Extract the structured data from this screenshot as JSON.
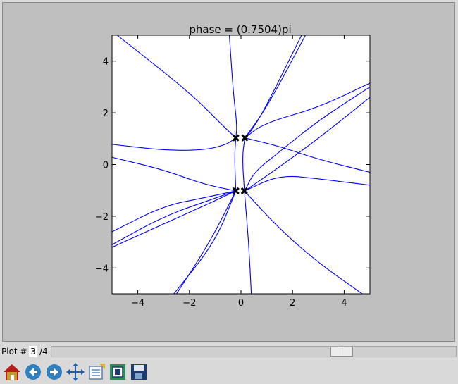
{
  "plot": {
    "title": "phase = (0.7504)pi",
    "xlim": [
      -5,
      5
    ],
    "ylim": [
      -5,
      5
    ],
    "xticks": [
      "−4",
      "−2",
      "0",
      "2",
      "4"
    ],
    "yticks": [
      "4",
      "2",
      "0",
      "−2",
      "−4"
    ],
    "xtick_values": [
      -4,
      -2,
      0,
      2,
      4
    ],
    "ytick_values": [
      4,
      2,
      0,
      -2,
      -4
    ],
    "line_color": "#0000ff",
    "marker_color": "#000000",
    "background": "#ffffff",
    "canvas_bg": "#bfbfbf"
  },
  "chart_data": {
    "type": "line",
    "title": "phase = (0.7504)pi",
    "xlabel": "",
    "ylabel": "",
    "xlim": [
      -5,
      5
    ],
    "ylim": [
      -5,
      5
    ],
    "grid": false,
    "markers": [
      {
        "x": -0.2,
        "y": 1.03
      },
      {
        "x": 0.15,
        "y": 1.03
      },
      {
        "x": -0.2,
        "y": -1.02
      },
      {
        "x": 0.13,
        "y": -1.02
      }
    ],
    "series": [
      {
        "values": [
          [
            -4.8,
            5.0
          ],
          [
            -2.0,
            2.8
          ],
          [
            -0.6,
            1.4
          ],
          [
            -0.2,
            1.03
          ]
        ]
      },
      {
        "values": [
          [
            -0.45,
            5.0
          ],
          [
            -0.3,
            2.8
          ],
          [
            -0.15,
            1.5
          ],
          [
            -0.2,
            1.03
          ],
          [
            -0.25,
            0.3
          ],
          [
            -0.2,
            -1.02
          ]
        ]
      },
      {
        "values": [
          [
            -5.0,
            0.78
          ],
          [
            -3.0,
            0.55
          ],
          [
            -1.5,
            0.55
          ],
          [
            -0.6,
            0.75
          ],
          [
            -0.2,
            1.03
          ]
        ]
      },
      {
        "values": [
          [
            -5.0,
            0.28
          ],
          [
            -3.0,
            -0.2
          ],
          [
            -1.5,
            -0.75
          ],
          [
            -0.2,
            -1.02
          ]
        ]
      },
      {
        "values": [
          [
            2.5,
            5.0
          ],
          [
            1.0,
            2.2
          ],
          [
            0.15,
            1.03
          ]
        ]
      },
      {
        "values": [
          [
            2.35,
            5.0
          ],
          [
            0.9,
            2.1
          ],
          [
            0.4,
            1.3
          ],
          [
            0.15,
            1.03
          ]
        ]
      },
      {
        "values": [
          [
            5.0,
            3.15
          ],
          [
            3.0,
            2.2
          ],
          [
            0.9,
            1.6
          ],
          [
            0.15,
            1.03
          ]
        ]
      },
      {
        "values": [
          [
            5.0,
            3.0
          ],
          [
            3.0,
            1.7
          ],
          [
            1.5,
            0.5
          ],
          [
            0.5,
            -0.3
          ],
          [
            0.15,
            -1.02
          ]
        ]
      },
      {
        "values": [
          [
            5.0,
            2.6
          ],
          [
            3.0,
            1.0
          ],
          [
            1.2,
            -0.3
          ],
          [
            0.15,
            -1.02
          ]
        ]
      },
      {
        "values": [
          [
            0.15,
            1.03
          ],
          [
            0.05,
            0.3
          ],
          [
            0.13,
            -1.02
          ],
          [
            0.3,
            -3.0
          ],
          [
            0.4,
            -5.0
          ]
        ]
      },
      {
        "values": [
          [
            0.15,
            1.03
          ],
          [
            1.5,
            0.7
          ],
          [
            3.0,
            0.2
          ],
          [
            5.0,
            -0.3
          ]
        ]
      },
      {
        "values": [
          [
            0.15,
            -1.02
          ],
          [
            1.5,
            -0.4
          ],
          [
            3.0,
            -0.55
          ],
          [
            5.0,
            -0.8
          ]
        ]
      },
      {
        "values": [
          [
            0.13,
            -1.02
          ],
          [
            1.5,
            -2.5
          ],
          [
            3.0,
            -3.8
          ],
          [
            4.7,
            -5.0
          ]
        ]
      },
      {
        "values": [
          [
            -0.2,
            -1.02
          ],
          [
            -1.0,
            -3.0
          ],
          [
            -2.6,
            -5.0
          ]
        ]
      },
      {
        "values": [
          [
            -0.2,
            -1.02
          ],
          [
            -1.2,
            -3.0
          ],
          [
            -2.5,
            -5.0
          ]
        ]
      },
      {
        "values": [
          [
            -5.0,
            -2.6
          ],
          [
            -3.0,
            -1.6
          ],
          [
            -1.5,
            -1.3
          ],
          [
            -0.2,
            -1.02
          ]
        ]
      },
      {
        "values": [
          [
            -5.0,
            -3.1
          ],
          [
            -3.0,
            -2.0
          ],
          [
            -1.0,
            -1.3
          ],
          [
            -0.2,
            -1.02
          ]
        ]
      },
      {
        "values": [
          [
            -5.0,
            -3.2
          ],
          [
            -3.0,
            -2.3
          ],
          [
            -1.0,
            -1.4
          ],
          [
            -0.2,
            -1.02
          ]
        ]
      }
    ]
  },
  "nav": {
    "plot_label": "Plot #",
    "plot_number": "3",
    "plot_total": "/4",
    "slider_fraction": 0.73
  },
  "toolbar": {
    "colors": {
      "home_roof": "#b81c1c",
      "home_body": "#c89a2c",
      "arrow_blue": "#2f7fbf",
      "move_blue": "#1f5fa8",
      "disk_blue": "#1e3a6e"
    },
    "icons": [
      "home-icon",
      "back-arrow-icon",
      "forward-arrow-icon",
      "pan-move-icon",
      "configure-subplots-icon",
      "zoom-rect-icon",
      "save-disk-icon"
    ]
  }
}
